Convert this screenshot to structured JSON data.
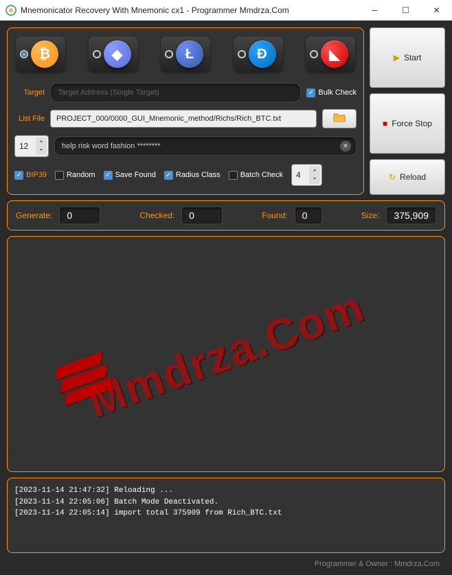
{
  "window": {
    "title": "Mnemonicator Recovery With Mnemonic cx1 - Programmer Mmdrza.Com"
  },
  "coins": {
    "btc_selected": true,
    "eth_selected": false,
    "ltc_selected": false,
    "dash_selected": false,
    "trx_selected": false
  },
  "form": {
    "target_label": "Target",
    "target_placeholder": "Target Address (Single Target)",
    "bulk_check_label": "Bulk Check",
    "bulk_check_checked": true,
    "listfile_label": "List File",
    "listfile_value": "PROJECT_000/0000_GUI_Mnemonic_method/Richs/Rich_BTC.txt",
    "word_count": "12",
    "phrase_value": "help risk word fashion ********"
  },
  "checks": {
    "bip39_label": "BIP39",
    "bip39_checked": true,
    "random_label": "Random",
    "random_checked": false,
    "save_label": "Save Found",
    "save_checked": true,
    "radius_label": "Radius Class",
    "radius_checked": true,
    "batch_label": "Batch Check",
    "batch_checked": false,
    "batch_value": "4"
  },
  "side": {
    "start_label": "Start",
    "stop_label": "Force Stop",
    "reload_label": "Reload"
  },
  "stats": {
    "generate_label": "Generate:",
    "generate_value": "0",
    "checked_label": "Checked:",
    "checked_value": "0",
    "found_label": "Found:",
    "found_value": "0",
    "size_label": "Size:",
    "size_value": "375,909"
  },
  "watermark": "Mmdrza.Com",
  "log": {
    "line1": "[2023-11-14 21:47:32] Reloading ...",
    "line2": "[2023-11-14 22:05:06] Batch Mode Deactivated.",
    "line3": "[2023-11-14 22:05:14] import total 375909 from Rich_BTC.txt"
  },
  "footer": "Programmer & Owner : Mmdrza.Com"
}
